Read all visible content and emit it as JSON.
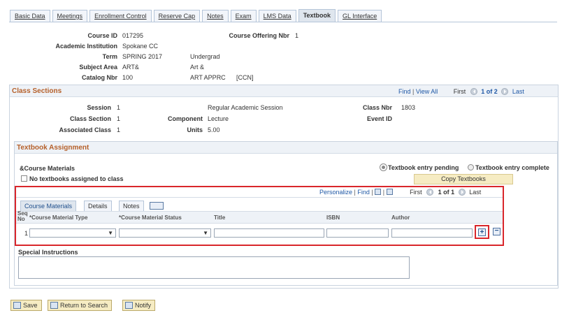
{
  "tabs": [
    "Basic Data",
    "Meetings",
    "Enrollment Control",
    "Reserve Cap",
    "Notes",
    "Exam",
    "LMS Data",
    "Textbook",
    "GL Interface"
  ],
  "header": {
    "course_id_label": "Course ID",
    "course_id": "017295",
    "course_offering_label": "Course Offering Nbr",
    "course_offering": "1",
    "institution_label": "Academic Institution",
    "institution": "Spokane CC",
    "term_label": "Term",
    "term": "SPRING 2017",
    "career": "Undergrad",
    "subject_label": "Subject Area",
    "subject": "ART&",
    "subject_desc": "Art &",
    "catalog_label": "Catalog Nbr",
    "catalog": "100",
    "catalog_desc": "ART APPRC",
    "catalog_code": "[CCN]"
  },
  "class_sections": {
    "title": "Class Sections",
    "find": "Find",
    "view_all": "View All",
    "first": "First",
    "count": "1 of 2",
    "last": "Last",
    "session_label": "Session",
    "session": "1",
    "session_desc": "Regular Academic Session",
    "class_nbr_label": "Class Nbr",
    "class_nbr": "1803",
    "class_section_label": "Class Section",
    "class_section": "1",
    "component_label": "Component",
    "component": "Lecture",
    "event_id_label": "Event ID",
    "assoc_label": "Associated Class",
    "assoc": "1",
    "units_label": "Units",
    "units": "5.00"
  },
  "textbook": {
    "title": "Textbook Assignment",
    "course_materials": "&Course Materials",
    "no_textbooks": "No textbooks assigned to class",
    "entry_pending": "Textbook entry pending",
    "entry_complete": "Textbook entry complete",
    "copy_button": "Copy Textbooks",
    "grid": {
      "personalize": "Personalize",
      "find": "Find",
      "first": "First",
      "count": "1 of 1",
      "last": "Last",
      "tabs": [
        "Course Materials",
        "Details",
        "Notes"
      ],
      "columns": [
        "Seq No",
        "*Course Material Type",
        "*Course Material Status",
        "Title",
        "ISBN",
        "Author"
      ],
      "row_seq": "1"
    },
    "special_instructions": "Special Instructions"
  },
  "buttons": {
    "save": "Save",
    "return_to_search": "Return to Search",
    "notify": "Notify"
  }
}
